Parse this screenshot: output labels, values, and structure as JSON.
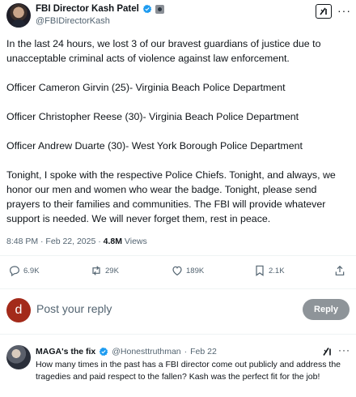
{
  "author": {
    "display_name": "FBI Director Kash Patel",
    "handle": "@FBIDirectorKash"
  },
  "tweet": {
    "paragraphs": [
      "In the last 24 hours, we lost 3 of our bravest guardians of justice due to unacceptable criminal acts of violence against law enforcement.",
      "Officer Cameron Girvin (25)- Virginia Beach Police Department",
      "Officer Christopher Reese (30)- Virginia Beach Police Department",
      "Officer Andrew Duarte (30)- West York Borough Police Department",
      "Tonight, I spoke with the respective Police Chiefs. Tonight, and always, we honor our men and women who wear the badge. Tonight, please send prayers to their families and communities. The FBI will provide whatever support is needed. We will never forget them, rest in peace."
    ],
    "timestamp": "8:48 PM · Feb 22, 2025 · ",
    "views_count": "4.8M",
    "views_label": " Views"
  },
  "actions": {
    "replies": "6.9K",
    "reposts": "29K",
    "likes": "189K",
    "bookmarks": "2.1K"
  },
  "reply_box": {
    "avatar_letter": "d",
    "placeholder": "Post your reply",
    "button_label": "Reply"
  },
  "comment": {
    "display_name": "MAGA's the fix",
    "handle": "@Honesttruthman",
    "separator": "·",
    "date": "Feb 22",
    "text": "How many times in the past has a FBI director come out publicly and address the tragedies and paid respect to the fallen?  Kash was the perfect fit for the job!"
  },
  "icons": {
    "verified": "verified-badge-icon",
    "gov_badge": "government-affiliation-icon",
    "grok": "grok-icon",
    "more": "more-icon",
    "reply": "reply-icon",
    "repost": "repost-icon",
    "like": "like-icon",
    "bookmark": "bookmark-icon",
    "share": "share-icon"
  },
  "colors": {
    "verified_blue": "#1d9bf0",
    "text_primary": "#0f1419",
    "text_secondary": "#536471",
    "reply_avatar": "#a32a1a",
    "reply_button": "#8e9499"
  }
}
